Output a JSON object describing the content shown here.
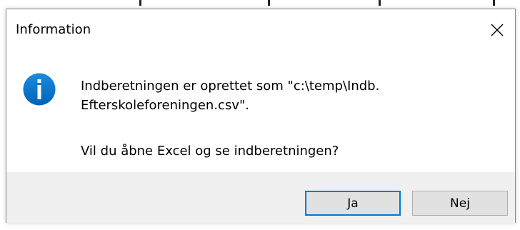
{
  "dialog": {
    "title": "Information",
    "close_icon": "close-icon",
    "icon": "info-icon",
    "message_line1": "Indberetningen er oprettet som \"c:\\temp\\Indb.",
    "message_line2": "Efterskoleforeningen.csv\".",
    "question": "Vil du åbne Excel og se indberetningen?",
    "buttons": {
      "yes_label": "Ja",
      "no_label": "Nej"
    }
  },
  "colors": {
    "accent": "#0078d7",
    "footer_bg": "#f0f0f0",
    "button_bg": "#e1e1e1"
  }
}
